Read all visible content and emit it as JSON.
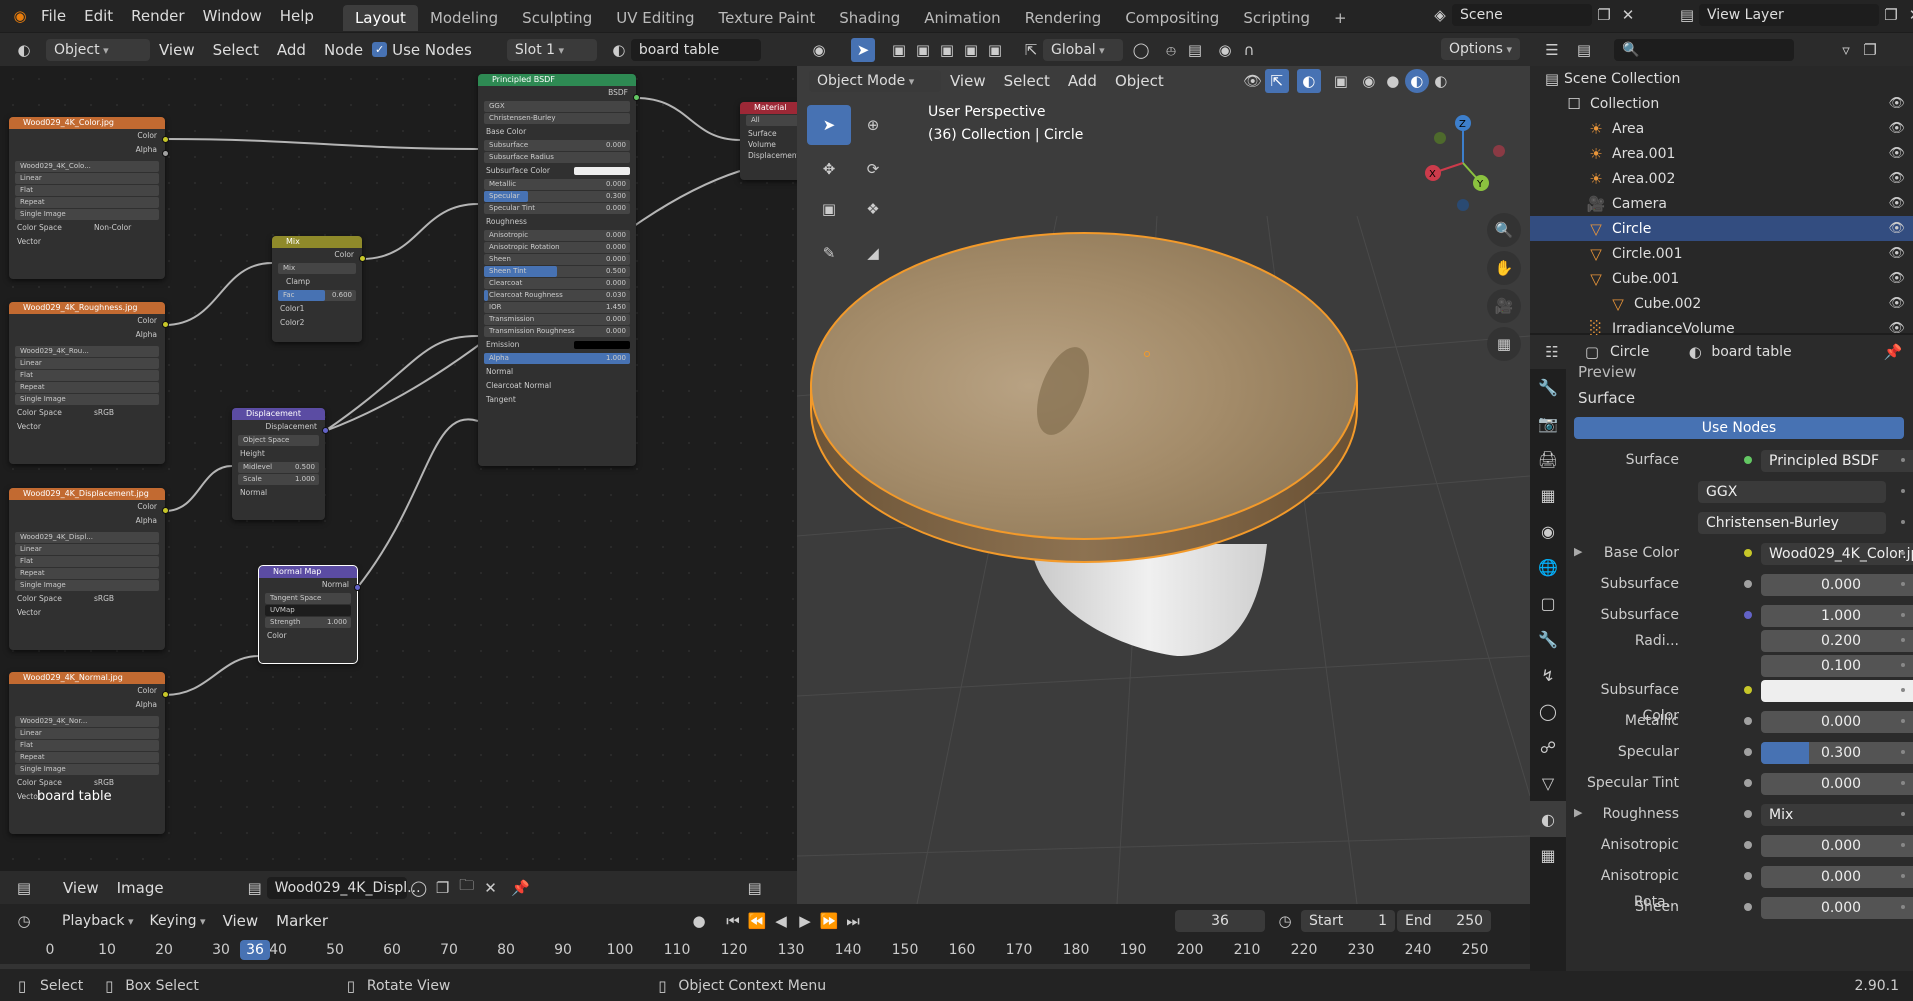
{
  "topbar": {
    "menus": [
      "File",
      "Edit",
      "Render",
      "Window",
      "Help"
    ],
    "workspaces": [
      "Layout",
      "Modeling",
      "Sculpting",
      "UV Editing",
      "Texture Paint",
      "Shading",
      "Animation",
      "Rendering",
      "Compositing",
      "Scripting"
    ],
    "active_workspace": "Layout",
    "add_tab_label": "+",
    "scene": "Scene",
    "view_layer": "View Layer"
  },
  "node_header": {
    "object": "Object",
    "view": "View",
    "select": "Select",
    "add": "Add",
    "node": "Node",
    "use_nodes": "Use Nodes",
    "slot": "Slot 1",
    "material": "board table"
  },
  "nodes": {
    "img_color": {
      "title": "Wood029_4K_Color.jpg",
      "out1": "Color",
      "out2": "Alpha",
      "file": "Wood029_4K_Colo...",
      "interp": "Linear",
      "proj": "Flat",
      "ext": "Repeat",
      "src": "Single Image",
      "cs_label": "Color Space",
      "cs_val": "Non-Color",
      "vector": "Vector"
    },
    "img_rough": {
      "title": "Wood029_4K_Roughness.jpg",
      "out1": "Color",
      "out2": "Alpha",
      "file": "Wood029_4K_Rou...",
      "interp": "Linear",
      "proj": "Flat",
      "ext": "Repeat",
      "src": "Single Image",
      "cs_label": "Color Space",
      "cs_val": "sRGB",
      "vector": "Vector"
    },
    "img_disp": {
      "title": "Wood029_4K_Displacement.jpg",
      "out1": "Color",
      "out2": "Alpha",
      "file": "Wood029_4K_Displ...",
      "interp": "Linear",
      "proj": "Flat",
      "ext": "Repeat",
      "src": "Single Image",
      "cs_label": "Color Space",
      "cs_val": "sRGB",
      "vector": "Vector"
    },
    "img_normal": {
      "title": "Wood029_4K_Normal.jpg",
      "out1": "Color",
      "out2": "Alpha",
      "file": "Wood029_4K_Nor...",
      "interp": "Linear",
      "proj": "Flat",
      "ext": "Repeat",
      "src": "Single Image",
      "cs_label": "Color Space",
      "cs_val": "sRGB",
      "vector": "Vector",
      "overlay": "board table"
    },
    "mix": {
      "title": "Mix",
      "out": "Color",
      "mode": "Mix",
      "clamp": "Clamp",
      "fac_label": "Fac",
      "fac": "0.600",
      "c1": "Color1",
      "c2": "Color2"
    },
    "disp": {
      "title": "Displacement",
      "out": "Displacement",
      "space": "Object Space",
      "height": "Height",
      "mid_label": "Midlevel",
      "mid": "0.500",
      "scale_label": "Scale",
      "scale": "1.000",
      "normal": "Normal"
    },
    "nmap": {
      "title": "Normal Map",
      "out": "Normal",
      "space": "Tangent Space",
      "uv": "UVMap",
      "str_label": "Strength",
      "str": "1.000",
      "color": "Color"
    },
    "bsdf": {
      "title": "Principled BSDF",
      "out": "BSDF",
      "dist": "GGX",
      "sss": "Christensen-Burley",
      "rows": [
        {
          "l": "Base Color",
          "t": "sock"
        },
        {
          "l": "Subsurface",
          "v": "0.000"
        },
        {
          "l": "Subsurface Radius",
          "t": "dd"
        },
        {
          "l": "Subsurface Color",
          "t": "white"
        },
        {
          "l": "Metallic",
          "v": "0.000"
        },
        {
          "l": "Specular",
          "v": "0.300",
          "f": 30
        },
        {
          "l": "Specular Tint",
          "v": "0.000"
        },
        {
          "l": "Roughness",
          "t": "sock"
        },
        {
          "l": "Anisotropic",
          "v": "0.000"
        },
        {
          "l": "Anisotropic Rotation",
          "v": "0.000"
        },
        {
          "l": "Sheen",
          "v": "0.000"
        },
        {
          "l": "Sheen Tint",
          "v": "0.500",
          "f": 50
        },
        {
          "l": "Clearcoat",
          "v": "0.000"
        },
        {
          "l": "Clearcoat Roughness",
          "v": "0.030",
          "f": 3
        },
        {
          "l": "IOR",
          "v": "1.450"
        },
        {
          "l": "Transmission",
          "v": "0.000"
        },
        {
          "l": "Transmission Roughness",
          "v": "0.000"
        },
        {
          "l": "Emission",
          "t": "black"
        },
        {
          "l": "Alpha",
          "v": "1.000",
          "f": 100
        },
        {
          "l": "Normal",
          "t": "sock"
        },
        {
          "l": "Clearcoat Normal",
          "t": "sock"
        },
        {
          "l": "Tangent",
          "t": "sock"
        }
      ]
    },
    "output": {
      "title": "Material Output",
      "target": "All",
      "surface": "Surface",
      "volume": "Volume",
      "displacement": "Displacement"
    }
  },
  "viewport": {
    "mode": "Object Mode",
    "view": "View",
    "select": "Select",
    "add": "Add",
    "object": "Object",
    "orientation": "Global",
    "options": "Options",
    "perspective": "User Perspective",
    "collection_info": "(36) Collection | Circle",
    "axes": {
      "x": "X",
      "y": "Y",
      "z": "Z"
    }
  },
  "outliner": {
    "search_placeholder": "",
    "scene_collection": "Scene Collection",
    "items": [
      {
        "name": "Collection",
        "indent": 1
      },
      {
        "name": "Area",
        "indent": 2
      },
      {
        "name": "Area.001",
        "indent": 2
      },
      {
        "name": "Area.002",
        "indent": 2
      },
      {
        "name": "Camera",
        "indent": 2
      },
      {
        "name": "Circle",
        "indent": 2,
        "selected": true
      },
      {
        "name": "Circle.001",
        "indent": 2
      },
      {
        "name": "Cube.001",
        "indent": 2
      },
      {
        "name": "Cube.002",
        "indent": 3
      },
      {
        "name": "IrradianceVolume",
        "indent": 2
      }
    ]
  },
  "props": {
    "object": "Circle",
    "material": "board table",
    "preview": "Preview",
    "surface_panel": "Surface",
    "use_nodes": "Use Nodes",
    "rows": [
      {
        "label": "Surface",
        "value": "Principled BSDF",
        "dot": "gr",
        "style": "dark"
      },
      {
        "label": "",
        "value": "GGX",
        "style": "dd"
      },
      {
        "label": "",
        "value": "Christensen-Burley",
        "style": "dd"
      },
      {
        "label": "Base Color",
        "value": "Wood029_4K_Color.jpg",
        "dot": "y",
        "style": "dark",
        "expand": true
      },
      {
        "label": "Subsurface",
        "value": "0.000",
        "dot": "g"
      },
      {
        "label": "Subsurface Radi...",
        "value": "1.000",
        "dot": "p"
      },
      {
        "label": "",
        "value": "0.200"
      },
      {
        "label": "",
        "value": "0.100"
      },
      {
        "label": "Subsurface Color",
        "value": "",
        "dot": "y",
        "style": "white"
      },
      {
        "label": "Metallic",
        "value": "0.000",
        "dot": "g"
      },
      {
        "label": "Specular",
        "value": "0.300",
        "dot": "g",
        "fill": 30
      },
      {
        "label": "Specular Tint",
        "value": "0.000",
        "dot": "g"
      },
      {
        "label": "Roughness",
        "value": "Mix",
        "dot": "g",
        "style": "dark",
        "expand": true
      },
      {
        "label": "Anisotropic",
        "value": "0.000",
        "dot": "g"
      },
      {
        "label": "Anisotropic Rota...",
        "value": "0.000",
        "dot": "g"
      },
      {
        "label": "Sheen",
        "value": "0.000",
        "dot": "g"
      }
    ]
  },
  "image_editor": {
    "view": "View",
    "image": "Image",
    "image_name": "Wood029_4K_Displ..."
  },
  "timeline": {
    "playback": "Playback",
    "keying": "Keying",
    "view": "View",
    "marker": "Marker",
    "current_frame": "36",
    "start_label": "Start",
    "start": "1",
    "end_label": "End",
    "end": "250",
    "ticks": [
      "0",
      "10",
      "20",
      "30",
      "40",
      "50",
      "60",
      "70",
      "80",
      "90",
      "100",
      "110",
      "120",
      "130",
      "140",
      "150",
      "160",
      "170",
      "180",
      "190",
      "200",
      "210",
      "220",
      "230",
      "240",
      "250"
    ]
  },
  "statusbar": {
    "select": "Select",
    "box_select": "Box Select",
    "rotate": "Rotate View",
    "context": "Object Context Menu",
    "version": "2.90.1"
  }
}
